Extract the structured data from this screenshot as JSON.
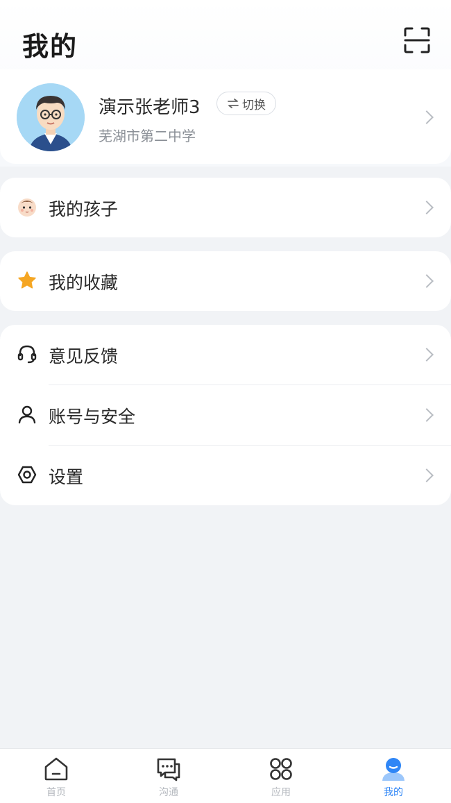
{
  "header": {
    "title": "我的",
    "scan_icon": "scan-icon"
  },
  "profile": {
    "name": "演示张老师3",
    "switch_label": "切换",
    "switch_icon": "swap-arrows-icon",
    "school": "芜湖市第二中学",
    "avatar": "teacher-avatar"
  },
  "menu": {
    "children": {
      "label": "我的孩子",
      "icon": "baby-face-icon"
    },
    "favorites": {
      "label": "我的收藏",
      "icon": "star-icon",
      "icon_color": "#f5a623"
    },
    "feedback": {
      "label": "意见反馈",
      "icon": "headset-icon"
    },
    "account": {
      "label": "账号与安全",
      "icon": "user-icon"
    },
    "settings": {
      "label": "设置",
      "icon": "settings-icon"
    }
  },
  "tabbar": {
    "accent": "#2f86f6",
    "tabs": [
      {
        "label": "首页",
        "icon": "home-icon",
        "active": false
      },
      {
        "label": "沟通",
        "icon": "chat-icon",
        "active": false
      },
      {
        "label": "应用",
        "icon": "apps-icon",
        "active": false
      },
      {
        "label": "我的",
        "icon": "profile-icon",
        "active": true
      }
    ]
  }
}
